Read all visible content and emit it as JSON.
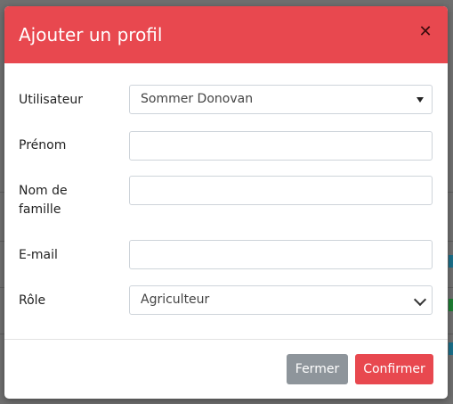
{
  "modal": {
    "title": "Ajouter un profil",
    "close_icon": "close-icon",
    "fields": {
      "user": {
        "label": "Utilisateur",
        "value": "Sommer Donovan"
      },
      "first_name": {
        "label": "Prénom",
        "value": ""
      },
      "last_name": {
        "label": "Nom de famille",
        "label_line1": "Nom de",
        "label_line2": "famille",
        "value": ""
      },
      "email": {
        "label": "E-mail",
        "value": ""
      },
      "role": {
        "label": "Rôle",
        "value": "Agriculteur"
      }
    },
    "footer": {
      "close_label": "Fermer",
      "confirm_label": "Confirmer"
    }
  },
  "colors": {
    "header": "#e8484f",
    "confirm": "#e8484f",
    "close_button": "#8e959b",
    "backdrop": "#6f6f6f"
  }
}
